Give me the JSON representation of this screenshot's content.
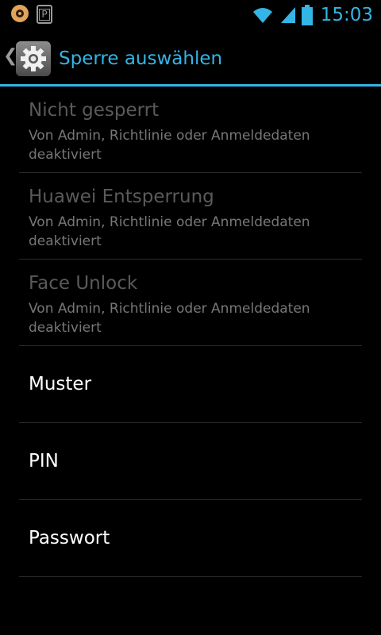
{
  "status_bar": {
    "time": "15:03",
    "notifications": [
      {
        "icon": "app-notification-icon"
      },
      {
        "icon": "parking-notification-icon",
        "label": "P"
      }
    ],
    "indicators": [
      "wifi-icon",
      "signal-icon",
      "battery-icon"
    ],
    "accent_color": "#33b5e5"
  },
  "action_bar": {
    "title": "Sperre auswählen",
    "icon": "settings-gear-icon",
    "accent_color": "#33b5e5"
  },
  "options": [
    {
      "title": "Nicht gesperrt",
      "summary": "Von Admin, Richtlinie oder Anmeldedaten deaktiviert",
      "enabled": false
    },
    {
      "title": "Huawei Entsperrung",
      "summary": "Von Admin, Richtlinie oder Anmeldedaten deaktiviert",
      "enabled": false
    },
    {
      "title": "Face Unlock",
      "summary": "Von Admin, Richtlinie oder Anmeldedaten deaktiviert",
      "enabled": false
    },
    {
      "title": "Muster",
      "enabled": true
    },
    {
      "title": "PIN",
      "enabled": true
    },
    {
      "title": "Passwort",
      "enabled": true
    }
  ]
}
